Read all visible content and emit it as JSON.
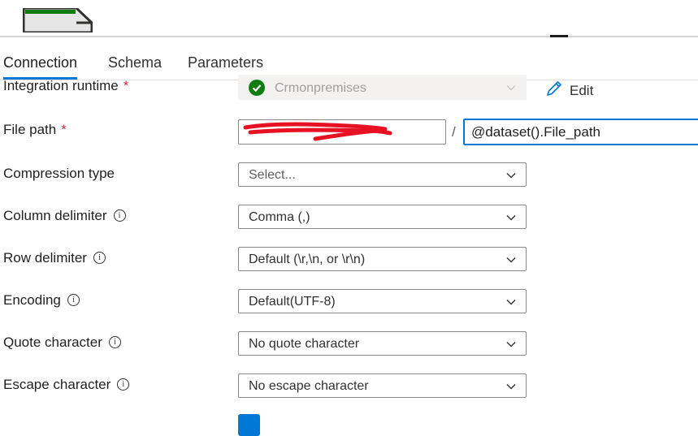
{
  "tabs": [
    {
      "label": "Connection"
    },
    {
      "label": "Schema"
    },
    {
      "label": "Parameters"
    }
  ],
  "fields": {
    "integration_runtime": {
      "label": "Integration runtime",
      "required_mark": "*",
      "value": "Crmonpremises",
      "edit_label": "Edit"
    },
    "file_path": {
      "label": "File path",
      "required_mark": "*",
      "container_value": "",
      "path_separator": "/",
      "file_value": "@dataset().File_path"
    },
    "compression_type": {
      "label": "Compression type",
      "placeholder": "Select..."
    },
    "column_delimiter": {
      "label": "Column delimiter",
      "value": "Comma (,)"
    },
    "row_delimiter": {
      "label": "Row delimiter",
      "value": "Default (\\r,\\n, or \\r\\n)"
    },
    "encoding": {
      "label": "Encoding",
      "value": "Default(UTF-8)"
    },
    "quote_character": {
      "label": "Quote character",
      "value": "No quote character"
    },
    "escape_character": {
      "label": "Escape character",
      "value": "No escape character"
    }
  },
  "info_glyph": "i",
  "colors": {
    "accent": "#0078d4",
    "success": "#107c10",
    "redaction": "#e81123"
  }
}
